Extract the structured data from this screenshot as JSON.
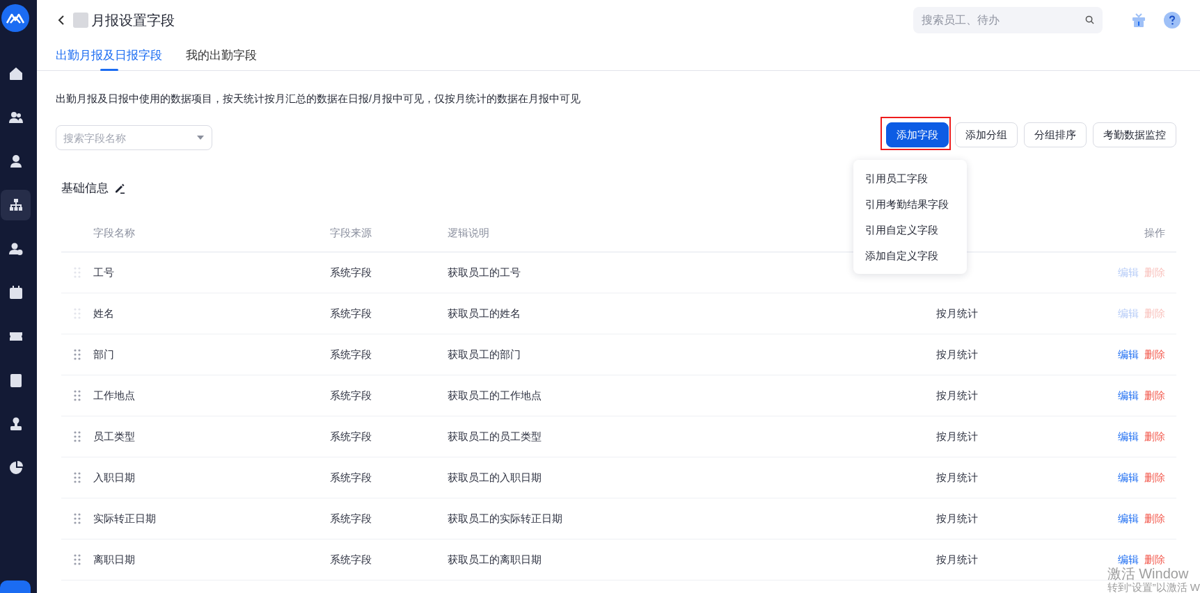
{
  "sidebar": {
    "items": [
      {
        "selected": false
      },
      {
        "selected": false
      },
      {
        "selected": false
      },
      {
        "selected": true
      },
      {
        "selected": false
      },
      {
        "selected": false
      },
      {
        "selected": false
      },
      {
        "selected": false
      },
      {
        "selected": false
      },
      {
        "selected": false
      }
    ]
  },
  "header": {
    "title": "月报设置字段",
    "search": {
      "placeholder": "搜索员工、待办"
    }
  },
  "tabs": [
    {
      "label": "出勤月报及日报字段",
      "selected": true
    },
    {
      "label": "我的出勤字段",
      "selected": false
    }
  ],
  "description": "出勤月报及日报中使用的数据项目，按天统计按月汇总的数据在日报/月报中可见，仅按月统计的数据在月报中可见",
  "field_search": {
    "placeholder": "搜索字段名称"
  },
  "buttons": [
    {
      "label": "添加字段",
      "kind": "primary",
      "highlighted": true
    },
    {
      "label": "添加分组",
      "kind": "default",
      "highlighted": false
    },
    {
      "label": "分组排序",
      "kind": "default",
      "highlighted": false
    },
    {
      "label": "考勤数据监控",
      "kind": "default",
      "highlighted": false
    }
  ],
  "dropdown": {
    "items": [
      "引用员工字段",
      "引用考勤结果字段",
      "引用自定义字段",
      "添加自定义字段"
    ]
  },
  "section": {
    "title": "基础信息"
  },
  "table": {
    "columns": {
      "name": "字段名称",
      "source": "字段来源",
      "logic": "逻辑说明",
      "actions": "操作"
    },
    "rows": [
      {
        "name": "工号",
        "source": "系统字段",
        "logic": "获取员工的工号",
        "disabled": true,
        "actions": [
          "编辑",
          "删除"
        ]
      },
      {
        "name": "姓名",
        "source": "系统字段",
        "logic": "获取员工的姓名",
        "method": "按月统计",
        "disabled": true,
        "actions": [
          "编辑",
          "删除"
        ]
      },
      {
        "name": "部门",
        "source": "系统字段",
        "logic": "获取员工的部门",
        "method": "按月统计",
        "disabled": false,
        "actions": [
          "编辑",
          "删除"
        ]
      },
      {
        "name": "工作地点",
        "source": "系统字段",
        "logic": "获取员工的工作地点",
        "method": "按月统计",
        "disabled": false,
        "actions": [
          "编辑",
          "删除"
        ]
      },
      {
        "name": "员工类型",
        "source": "系统字段",
        "logic": "获取员工的员工类型",
        "method": "按月统计",
        "disabled": false,
        "actions": [
          "编辑",
          "删除"
        ]
      },
      {
        "name": "入职日期",
        "source": "系统字段",
        "logic": "获取员工的入职日期",
        "method": "按月统计",
        "disabled": false,
        "actions": [
          "编辑",
          "删除"
        ]
      },
      {
        "name": "实际转正日期",
        "source": "系统字段",
        "logic": "获取员工的实际转正日期",
        "method": "按月统计",
        "disabled": false,
        "actions": [
          "编辑",
          "删除"
        ]
      },
      {
        "name": "离职日期",
        "source": "系统字段",
        "logic": "获取员工的离职日期",
        "method": "按月统计",
        "disabled": false,
        "actions": [
          "编辑",
          "删除"
        ]
      }
    ]
  },
  "os_overlay": {
    "title": "激活 Window",
    "subtitle": "转到“设置”以激活 W"
  }
}
